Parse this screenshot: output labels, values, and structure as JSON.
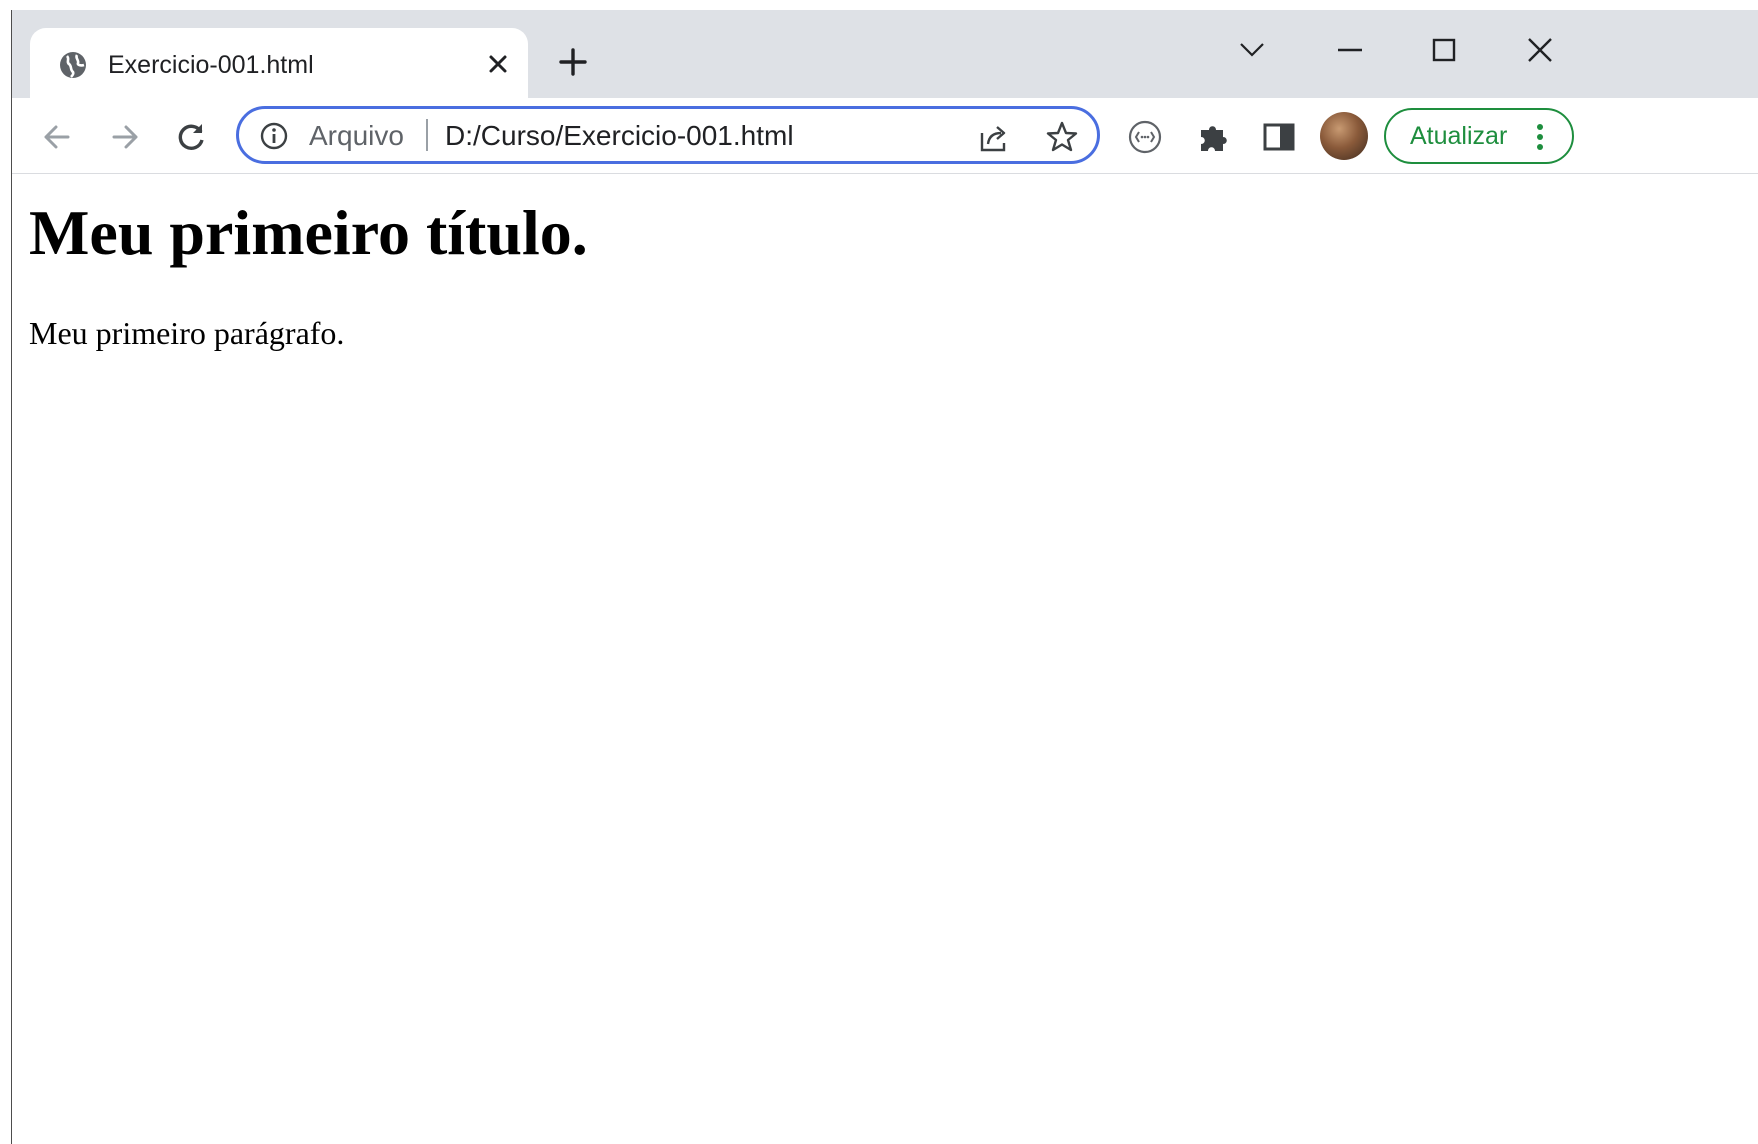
{
  "browser": {
    "tab": {
      "title": "Exercicio-001.html",
      "favicon": "globe-icon"
    },
    "window_controls": [
      "tab-search-chevron-icon",
      "minimize-icon",
      "maximize-icon",
      "close-window-icon"
    ],
    "toolbar": {
      "back_icon": "back-arrow-icon",
      "forward_icon": "forward-arrow-icon",
      "reload_icon": "reload-icon",
      "omnibox": {
        "scheme_label": "Arquivo",
        "url": "D:/Curso/Exercicio-001.html",
        "accent_color": "#4a6ee0"
      },
      "update_button": {
        "label": "Atualizar",
        "color": "#1e8e3e"
      }
    }
  },
  "page": {
    "heading": "Meu primeiro título.",
    "paragraph": "Meu primeiro parágrafo."
  }
}
